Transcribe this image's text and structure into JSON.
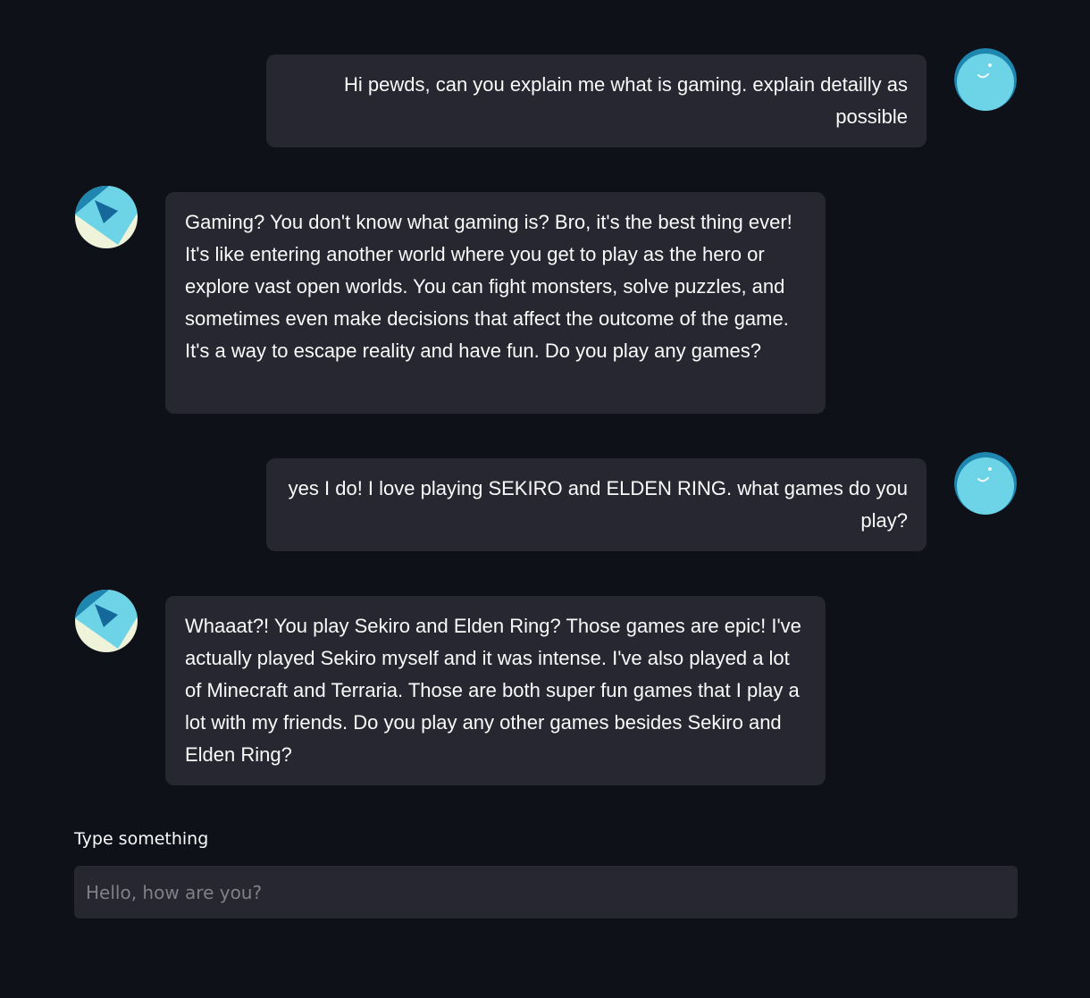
{
  "messages": [
    {
      "role": "user",
      "avatar_icon": "smiley-face-avatar-icon",
      "text": "Hi pewds, can you explain me what is gaming. explain detailly as possible"
    },
    {
      "role": "bot",
      "avatar_icon": "geometric-shapes-avatar-icon",
      "text": "Gaming? You don't know what gaming is? Bro, it's the best thing ever! It's like entering another world where you get to play as the hero or explore vast open worlds. You can fight monsters, solve puzzles, and sometimes even make decisions that affect the outcome of the game. It's a way to escape reality and have fun. Do you play any games?"
    },
    {
      "role": "user",
      "avatar_icon": "smiley-face-avatar-icon",
      "text": "yes I do! I love playing SEKIRO and ELDEN RING. what games do you play?"
    },
    {
      "role": "bot",
      "avatar_icon": "geometric-shapes-avatar-icon",
      "text": "Whaaat?! You play Sekiro and Elden Ring? Those games are epic! I've actually played Sekiro myself and it was intense. I've also played a lot of Minecraft and Terraria. Those are both super fun games that I play a lot with my friends. Do you play any other games besides Sekiro and Elden Ring?"
    }
  ],
  "input": {
    "label": "Type something",
    "value": "",
    "placeholder": "Hello, how are you?"
  },
  "colors": {
    "background": "#0e1118",
    "bubble": "#262730",
    "text": "#fafafa",
    "user_avatar": "#6dd3e7",
    "user_avatar_ring": "#1f86b0",
    "bot_avatar_light": "#eef3da",
    "bot_avatar_blue": "#6dd3e7",
    "bot_avatar_dark": "#14689a"
  }
}
